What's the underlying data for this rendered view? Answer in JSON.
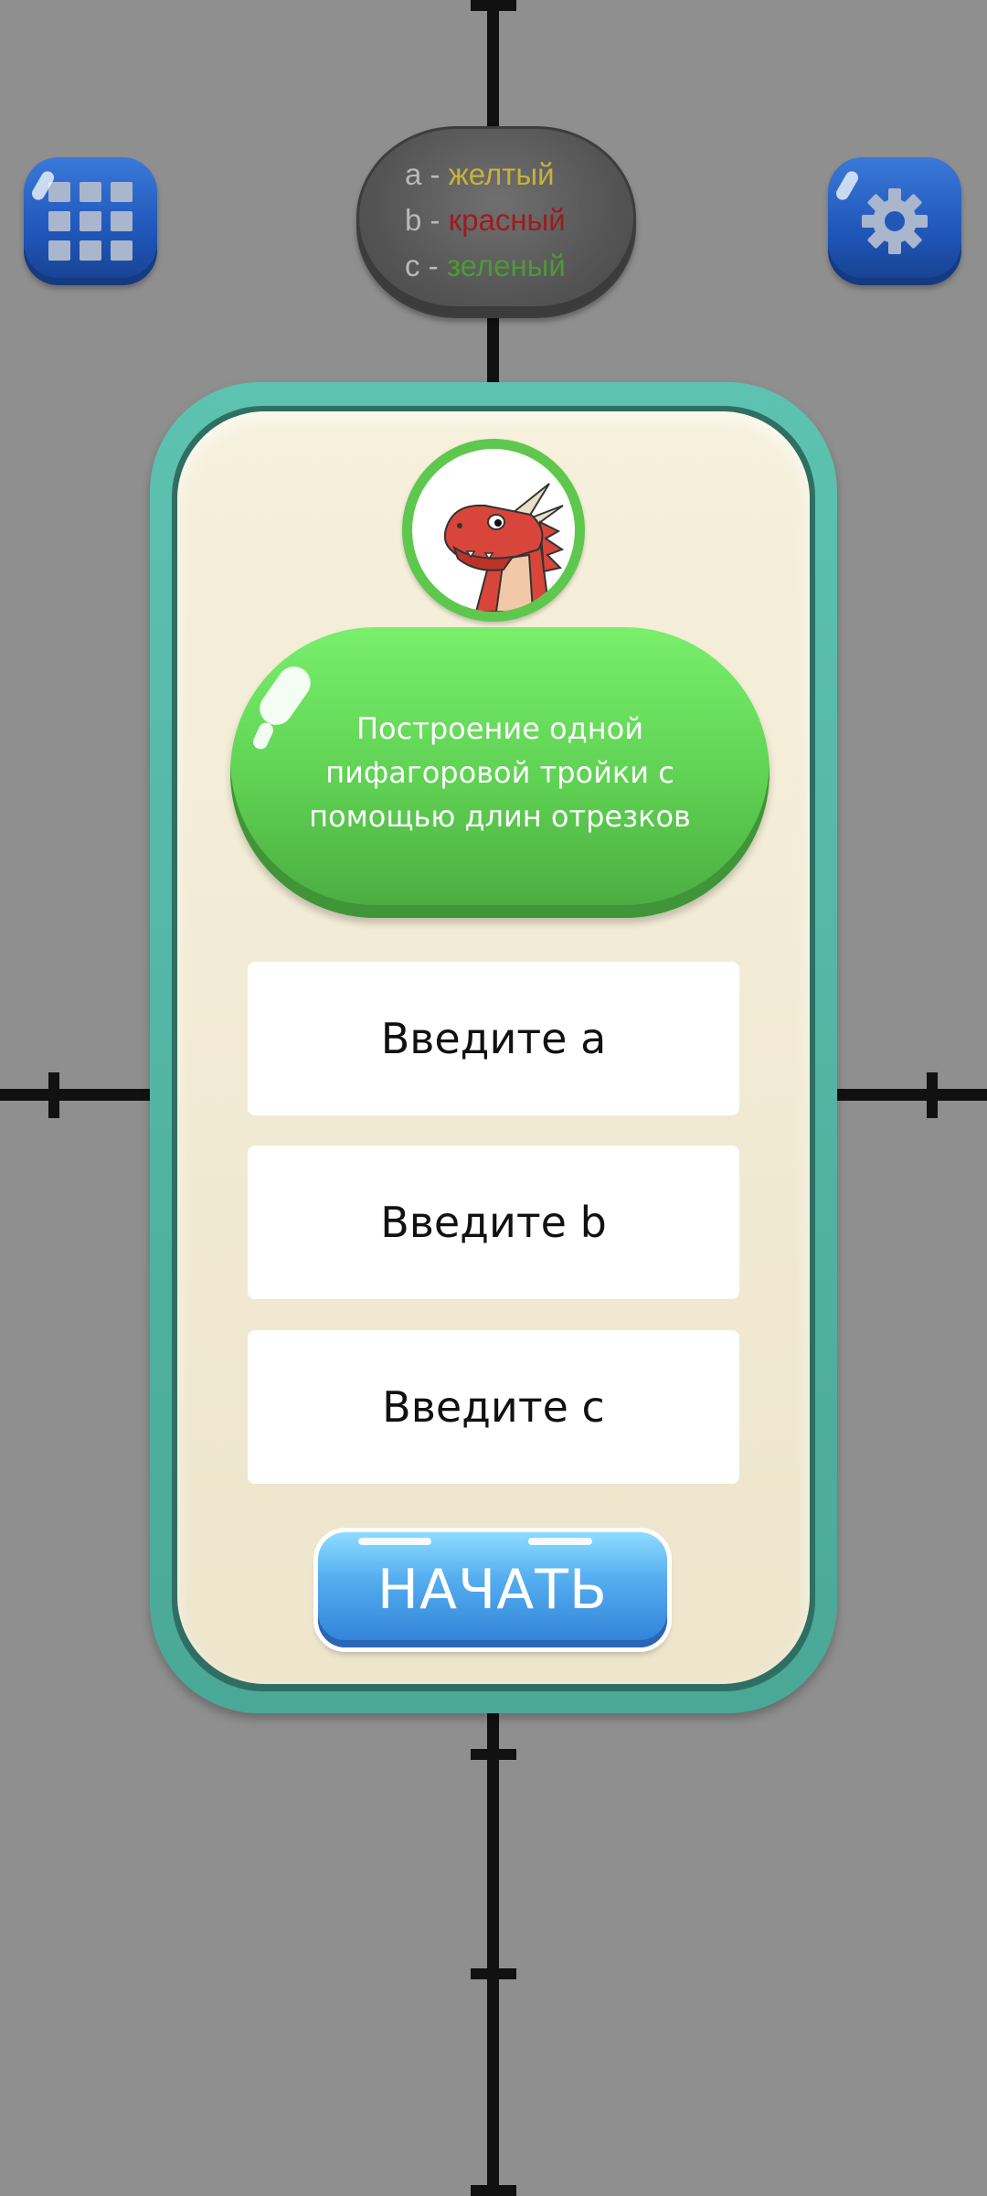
{
  "toolbar": {
    "menu_icon": "grid-icon",
    "settings_icon": "gear-icon"
  },
  "legend": {
    "rows": [
      {
        "letter": "a - ",
        "value": "желтый",
        "color": "#c6b23a"
      },
      {
        "letter": "b - ",
        "value": "красный",
        "color": "#9e1c1c"
      },
      {
        "letter": "c - ",
        "value": "зеленый",
        "color": "#4c9a36"
      }
    ]
  },
  "card": {
    "avatar_icon": "red-dragon-avatar",
    "title": "Построение одной пифагоровой тройки с помощью длин отрезков",
    "inputs": [
      {
        "placeholder": "Введите a",
        "value": ""
      },
      {
        "placeholder": "Введите b",
        "value": ""
      },
      {
        "placeholder": "Введите c",
        "value": ""
      }
    ],
    "start_label": "НАЧАТЬ"
  },
  "colors": {
    "background": "#8f8f8f",
    "card_frame": "#4fae9c",
    "card_fill": "#f3ecd6",
    "title_green": "#64d858",
    "button_blue": "#4a9ee8",
    "menu_blue": "#2460c4"
  }
}
